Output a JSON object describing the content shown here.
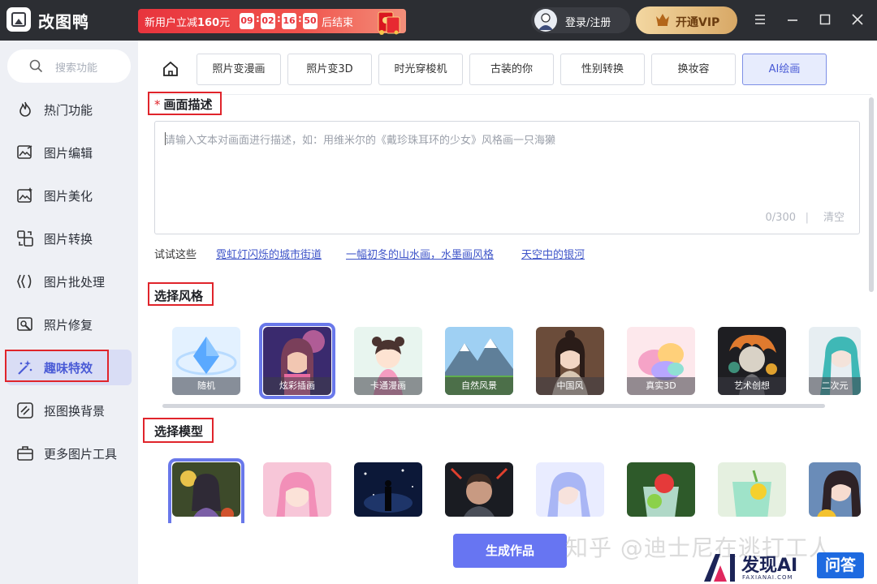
{
  "app": {
    "title": "改图鸭"
  },
  "promo": {
    "text_prefix": "新用户立减",
    "amount": "160",
    "unit": "元",
    "countdown": [
      "09",
      "02",
      "16",
      "50"
    ],
    "suffix": "后结束"
  },
  "header": {
    "login_label": "登录/注册",
    "vip_label": "开通VIP"
  },
  "sidebar": {
    "search_placeholder": "搜索功能",
    "items": [
      {
        "label": "热门功能",
        "icon": "flame-icon"
      },
      {
        "label": "图片编辑",
        "icon": "image-edit-icon"
      },
      {
        "label": "图片美化",
        "icon": "image-sparkle-icon"
      },
      {
        "label": "图片转换",
        "icon": "image-convert-icon"
      },
      {
        "label": "图片批处理",
        "icon": "batch-icon"
      },
      {
        "label": "照片修复",
        "icon": "photo-repair-icon"
      },
      {
        "label": "趣味特效",
        "icon": "magic-wand-icon",
        "active": true
      },
      {
        "label": "抠图换背景",
        "icon": "cutout-icon"
      },
      {
        "label": "更多图片工具",
        "icon": "toolbox-icon"
      }
    ]
  },
  "tabs": [
    {
      "label": "照片变漫画"
    },
    {
      "label": "照片变3D"
    },
    {
      "label": "时光穿梭机"
    },
    {
      "label": "古装的你"
    },
    {
      "label": "性别转换"
    },
    {
      "label": "换妆容"
    },
    {
      "label": "AI绘画",
      "active": true
    }
  ],
  "description": {
    "title": "画面描述",
    "required_mark": "*",
    "placeholder": "请输入文本对画面进行描述，如：用维米尔的《戴珍珠耳环的少女》风格画一只海獭",
    "counter": "0/300",
    "separator": "|",
    "clear_label": "清空",
    "try_label": "试试这些",
    "suggestions": [
      "霓虹灯闪烁的城市街道",
      "一幅初冬的山水画，水墨画风格",
      "天空中的银河"
    ]
  },
  "style": {
    "title": "选择风格",
    "selected_index": 1,
    "items": [
      "随机",
      "炫彩插画",
      "卡通漫画",
      "自然风景",
      "中国风",
      "真实3D",
      "艺术创想",
      "二次元"
    ]
  },
  "model": {
    "title": "选择模型",
    "selected_index": 0
  },
  "actions": {
    "generate_label": "生成作品"
  },
  "overlay": {
    "watermark": "知乎 @迪士尼在逃打工人",
    "badge_word": "发现AI",
    "badge_sub": "FAXIANAI.COM",
    "badge_qa": "问答"
  },
  "colors": {
    "accent": "#6775f2",
    "highlight_frame": "#e0242b",
    "titlebar": "#2c2e33"
  }
}
